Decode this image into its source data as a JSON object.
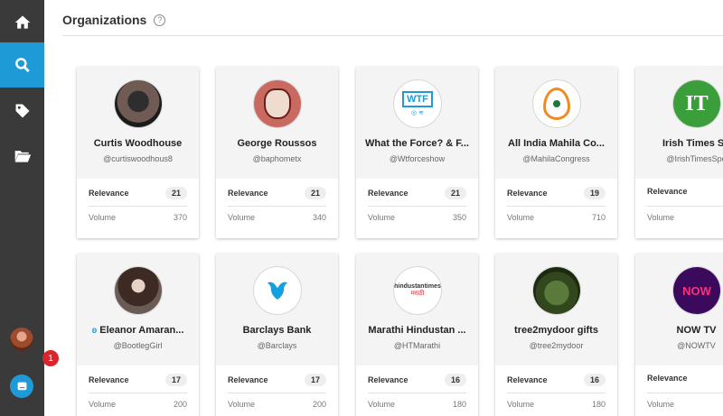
{
  "header": {
    "title": "Organizations",
    "help": "?"
  },
  "sidebar": {
    "items": [
      "home-icon",
      "search-icon",
      "tag-icon",
      "folder-icon"
    ],
    "notification_count": "1"
  },
  "cards": [
    {
      "name": "Curtis Woodhouse",
      "handle": "@curtiswoodhous8",
      "relevance_label": "Relevance",
      "relevance": "21",
      "volume_label": "Volume",
      "volume": "370"
    },
    {
      "name": "George Roussos",
      "handle": "@baphometx",
      "relevance_label": "Relevance",
      "relevance": "21",
      "volume_label": "Volume",
      "volume": "340"
    },
    {
      "name": "What the Force? & F...",
      "handle": "@Wtforceshow",
      "relevance_label": "Relevance",
      "relevance": "21",
      "volume_label": "Volume",
      "volume": "350",
      "logo": "WTF"
    },
    {
      "name": "All India Mahila Co...",
      "handle": "@MahilaCongress",
      "relevance_label": "Relevance",
      "relevance": "19",
      "volume_label": "Volume",
      "volume": "710"
    },
    {
      "name": "Irish Times Sp",
      "handle": "@IrishTimesSpo",
      "relevance_label": "Relevance",
      "relevance": "",
      "volume_label": "Volume",
      "volume": "",
      "logo": "IT"
    },
    {
      "name": "Eleanor Amaran...",
      "handle": "@BootlegGirl",
      "relevance_label": "Relevance",
      "relevance": "17",
      "volume_label": "Volume",
      "volume": "200"
    },
    {
      "name": "Barclays Bank",
      "handle": "@Barclays",
      "relevance_label": "Relevance",
      "relevance": "17",
      "volume_label": "Volume",
      "volume": "200"
    },
    {
      "name": "Marathi Hindustan ...",
      "handle": "@HTMarathi",
      "relevance_label": "Relevance",
      "relevance": "16",
      "volume_label": "Volume",
      "volume": "180",
      "logo": "hindustantimes"
    },
    {
      "name": "tree2mydoor gifts",
      "handle": "@tree2mydoor",
      "relevance_label": "Relevance",
      "relevance": "16",
      "volume_label": "Volume",
      "volume": "180"
    },
    {
      "name": "NOW TV",
      "handle": "@NOWTV",
      "relevance_label": "Relevance",
      "relevance": "",
      "volume_label": "Volume",
      "volume": "",
      "logo": "NOW"
    }
  ],
  "colors": {
    "accent": "#1e9bd7",
    "sidebar": "#3a3a3a",
    "irish_green": "#3a9e3a",
    "now_purple": "#3b0a5c"
  }
}
